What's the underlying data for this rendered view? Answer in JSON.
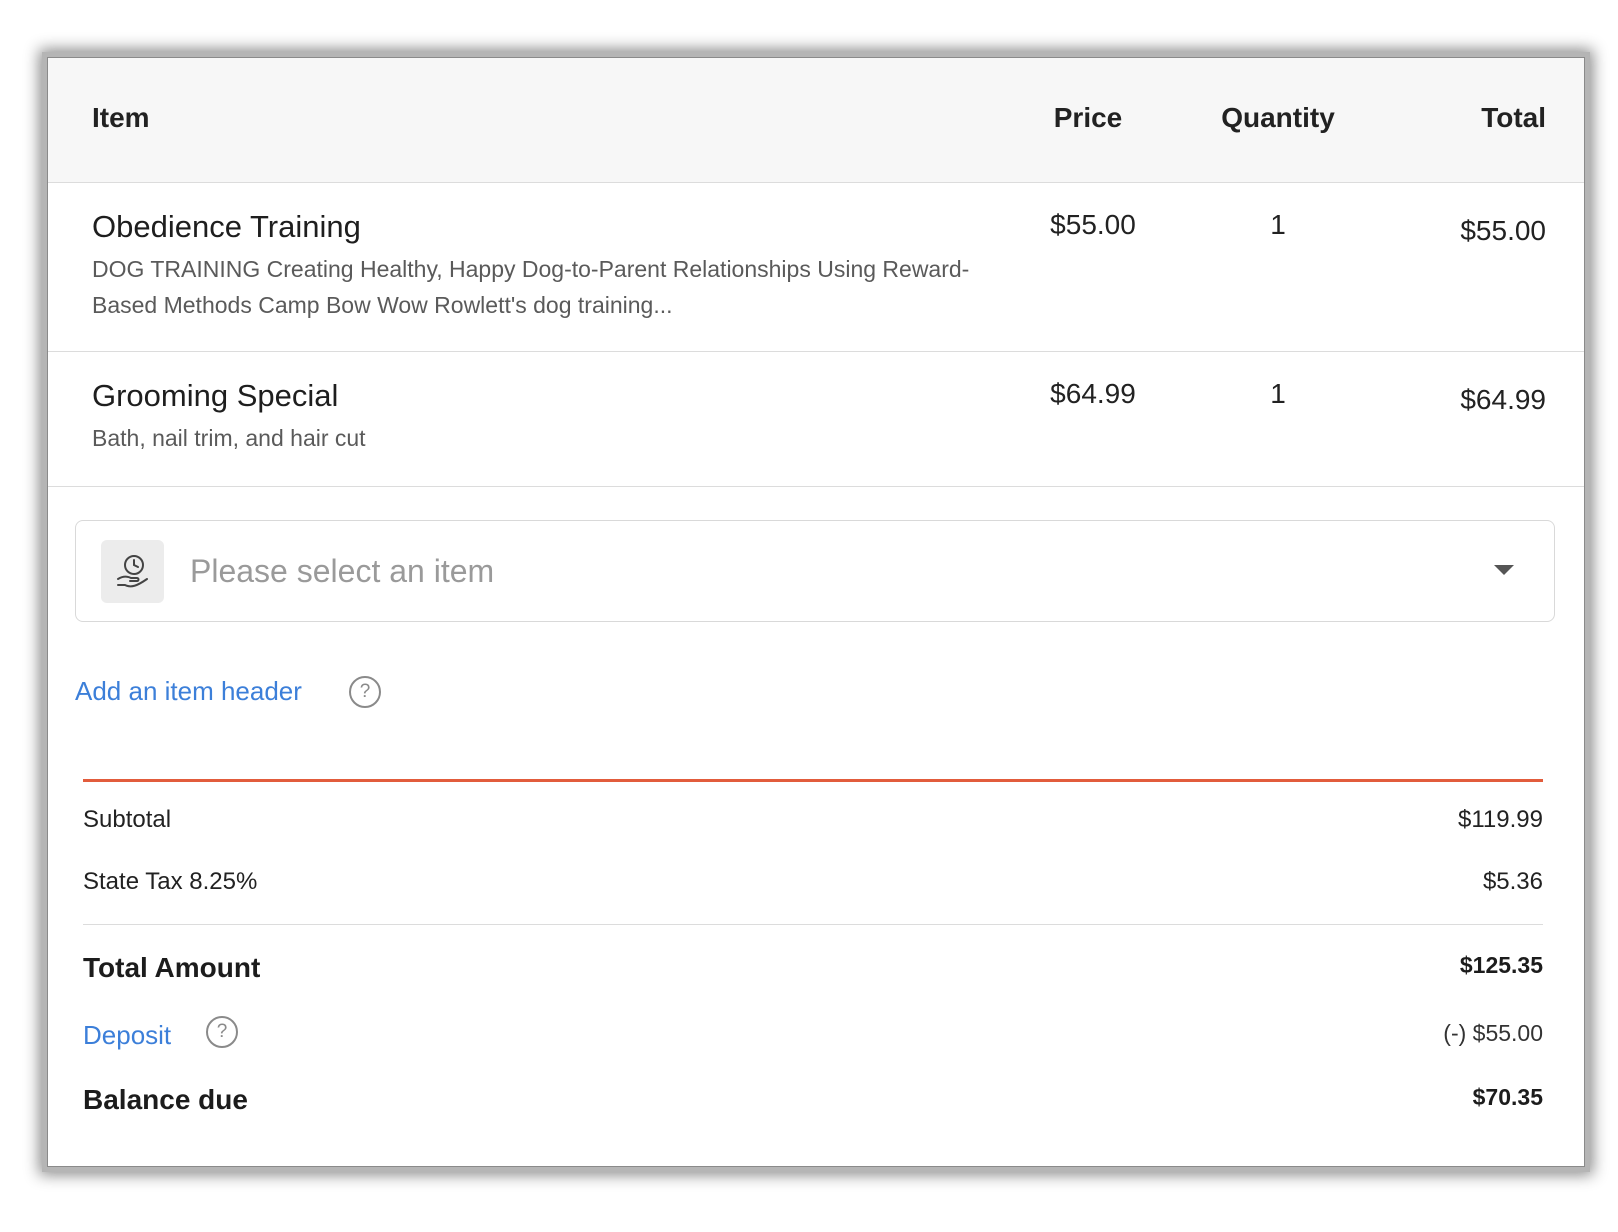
{
  "table": {
    "headers": {
      "item": "Item",
      "price": "Price",
      "quantity": "Quantity",
      "total": "Total"
    },
    "rows": [
      {
        "name": "Obedience Training",
        "description": "DOG TRAINING Creating Healthy, Happy Dog-to-Parent Relationships Using Reward-Based Methods Camp Bow Wow Rowlett's dog training...",
        "price": "$55.00",
        "quantity": "1",
        "total": "$55.00"
      },
      {
        "name": "Grooming Special",
        "description": "Bath, nail trim, and hair cut",
        "price": "$64.99",
        "quantity": "1",
        "total": "$64.99"
      }
    ]
  },
  "item_select": {
    "placeholder": "Please select an item",
    "icon": "hand-holding-clock-icon"
  },
  "add_header_label": "Add an item header",
  "help_glyph": "?",
  "summary": {
    "subtotal_label": "Subtotal",
    "subtotal_value": "$119.99",
    "tax_label": "State Tax 8.25%",
    "tax_value": "$5.36",
    "total_label": "Total Amount",
    "total_value": "$125.35",
    "deposit_label": "Deposit",
    "deposit_value": "(-) $55.00",
    "balance_label": "Balance due",
    "balance_value": "$70.35"
  },
  "colors": {
    "accent_line": "#e25c3c",
    "link": "#3c7fd9"
  }
}
